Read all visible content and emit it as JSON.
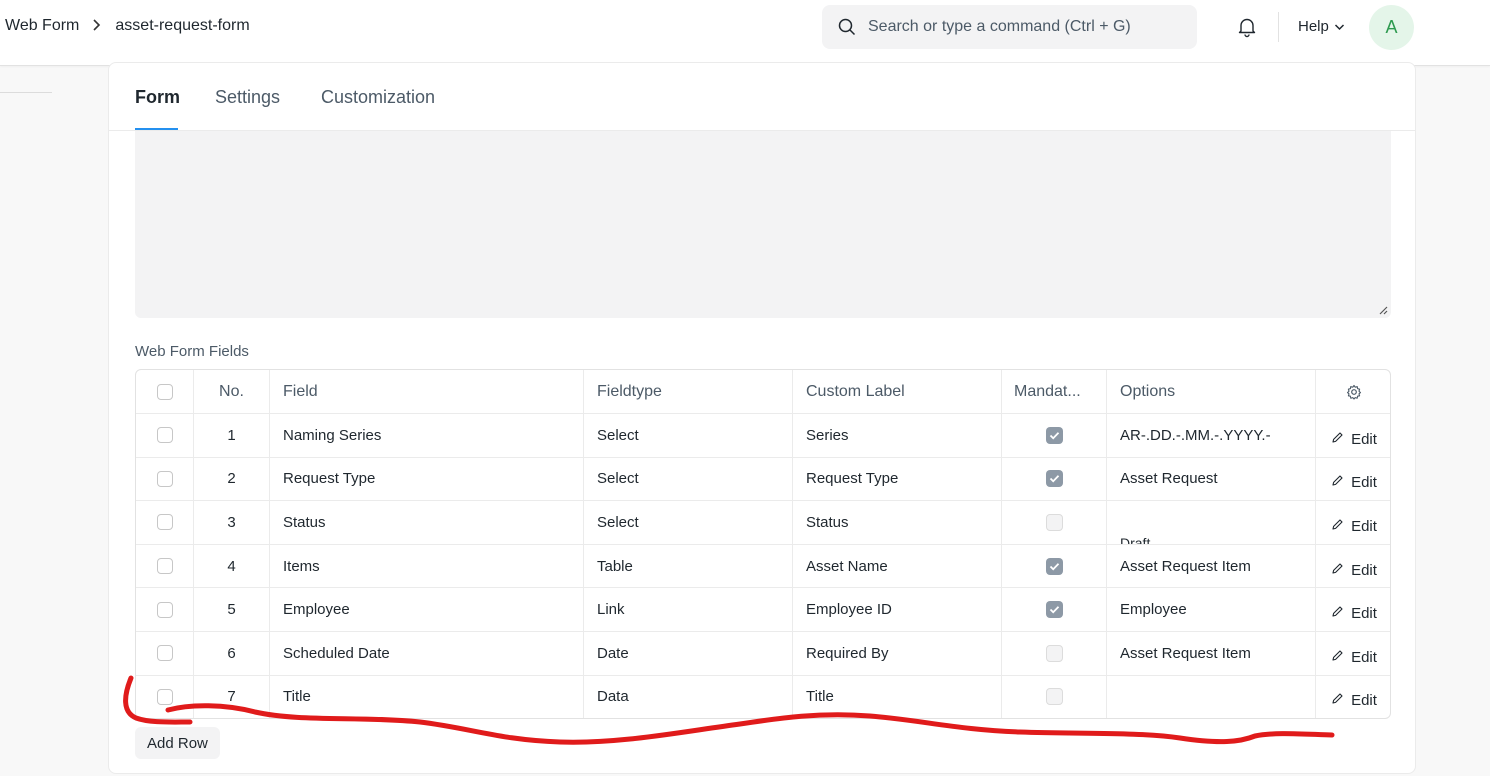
{
  "breadcrumb": {
    "parent": "Web Form",
    "current": "asset-request-form"
  },
  "search": {
    "placeholder": "Search or type a command (Ctrl + G)"
  },
  "header": {
    "help_label": "Help",
    "avatar_initial": "A"
  },
  "tabs": [
    {
      "label": "Form",
      "active": true
    },
    {
      "label": "Settings",
      "active": false
    },
    {
      "label": "Customization",
      "active": false
    }
  ],
  "section": {
    "title": "Web Form Fields"
  },
  "grid": {
    "columns": [
      "No.",
      "Field",
      "Fieldtype",
      "Custom Label",
      "Mandat...",
      "Options"
    ],
    "edit_label": "Edit",
    "rows": [
      {
        "no": "1",
        "field": "Naming Series",
        "fieldtype": "Select",
        "label": "Series",
        "mandatory": true,
        "options": "AR-.DD.-.MM.-.YYYY.-"
      },
      {
        "no": "2",
        "field": "Request Type",
        "fieldtype": "Select",
        "label": "Request Type",
        "mandatory": true,
        "options": "Asset Request"
      },
      {
        "no": "3",
        "field": "Status",
        "fieldtype": "Select",
        "label": "Status",
        "mandatory": false,
        "options": "Draft"
      },
      {
        "no": "4",
        "field": "Items",
        "fieldtype": "Table",
        "label": "Asset Name",
        "mandatory": true,
        "options": "Asset Request Item"
      },
      {
        "no": "5",
        "field": "Employee",
        "fieldtype": "Link",
        "label": "Employee ID",
        "mandatory": true,
        "options": "Employee"
      },
      {
        "no": "6",
        "field": "Scheduled Date",
        "fieldtype": "Date",
        "label": "Required By",
        "mandatory": false,
        "options": "Asset Request Item"
      },
      {
        "no": "7",
        "field": "Title",
        "fieldtype": "Data",
        "label": "Title",
        "mandatory": false,
        "options": ""
      }
    ]
  },
  "add_row_label": "Add Row",
  "colors": {
    "accent": "#2490ef",
    "annotation": "#e01b1b",
    "avatar_bg": "#e4f5e9",
    "avatar_fg": "#2d9a4f"
  }
}
